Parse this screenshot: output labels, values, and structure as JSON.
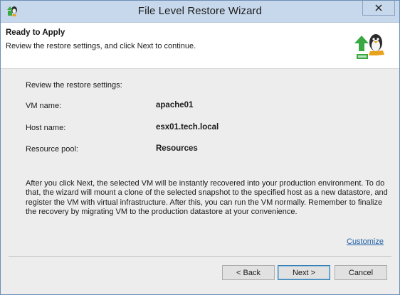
{
  "window": {
    "title": "File Level Restore Wizard",
    "close_glyph": "✕"
  },
  "header": {
    "title": "Ready to Apply",
    "description": "Review the restore settings, and click Next to continue.",
    "icon": "linux-penguin-restore-icon"
  },
  "content": {
    "intro": "Review the restore settings:",
    "fields": [
      {
        "label": "VM name:",
        "value": "apache01"
      },
      {
        "label": "Host name:",
        "value": "esx01.tech.local"
      },
      {
        "label": "Resource pool:",
        "value": "Resources"
      }
    ],
    "paragraph": "After you click Next, the selected VM will be instantly recovered into your production environment. To do that, the wizard will mount a clone of the selected snapshot to the specified host as a new datastore, and register the VM with virtual infrastructure. After this, you can run the VM normally. Remember to finalize the recovery by migrating VM to the production datastore at your convenience.",
    "customize_link": "Customize"
  },
  "buttons": {
    "back": "< Back",
    "next": "Next >",
    "cancel": "Cancel"
  },
  "colors": {
    "titlebar": "#c7d8ec",
    "link": "#1f5fa6",
    "icon_green": "#3aa843"
  }
}
